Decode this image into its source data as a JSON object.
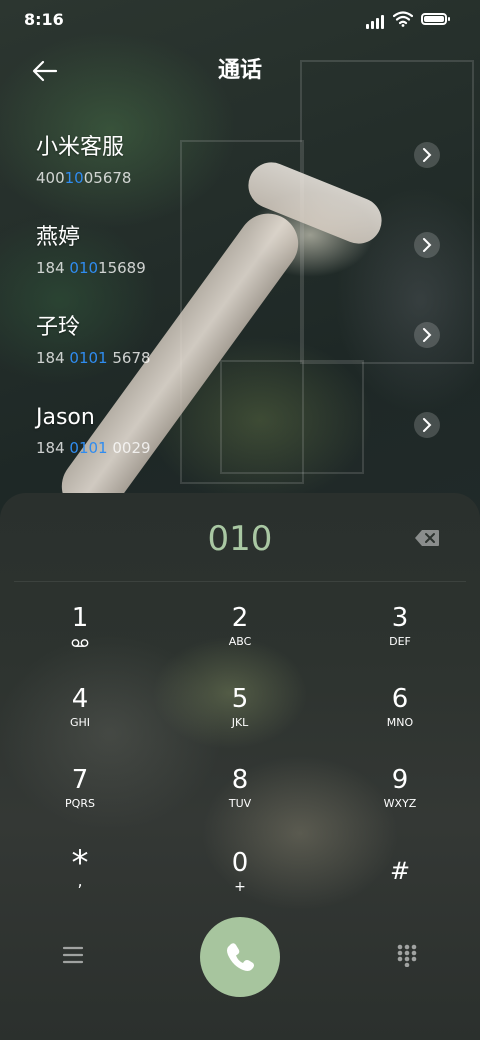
{
  "status_bar": {
    "time": "8:16"
  },
  "header": {
    "title": "通话"
  },
  "contacts": [
    {
      "name": "小米客服",
      "num_pre": "400",
      "num_hl": "10",
      "num_post": "05678"
    },
    {
      "name": "燕婷",
      "num_pre": "184 ",
      "num_hl": "010",
      "num_post": "15689"
    },
    {
      "name": "子玲",
      "num_pre": "184 ",
      "num_hl": "0101",
      "num_post": " 5678"
    },
    {
      "name": "Jason",
      "num_pre": "184 ",
      "num_hl": "0101",
      "num_post": " 0029"
    }
  ],
  "dialer": {
    "input": "010",
    "keys": [
      {
        "digit": "1",
        "letters": ""
      },
      {
        "digit": "2",
        "letters": "ABC"
      },
      {
        "digit": "3",
        "letters": "DEF"
      },
      {
        "digit": "4",
        "letters": "GHI"
      },
      {
        "digit": "5",
        "letters": "JKL"
      },
      {
        "digit": "6",
        "letters": "MNO"
      },
      {
        "digit": "7",
        "letters": "PQRS"
      },
      {
        "digit": "8",
        "letters": "TUV"
      },
      {
        "digit": "9",
        "letters": "WXYZ"
      },
      {
        "digit": "*",
        "letters": ","
      },
      {
        "digit": "0",
        "letters": "+"
      },
      {
        "digit": "#",
        "letters": ""
      }
    ]
  },
  "icons": {
    "back": "arrow-left-icon",
    "backspace": "backspace-icon",
    "menu": "menu-icon",
    "call": "phone-icon",
    "keypad": "dialpad-icon",
    "voicemail": "voicemail-icon"
  },
  "colors": {
    "accent_green": "#a7c59e",
    "match_highlight": "#2f8cf0",
    "input_text": "#a9c8a3"
  }
}
